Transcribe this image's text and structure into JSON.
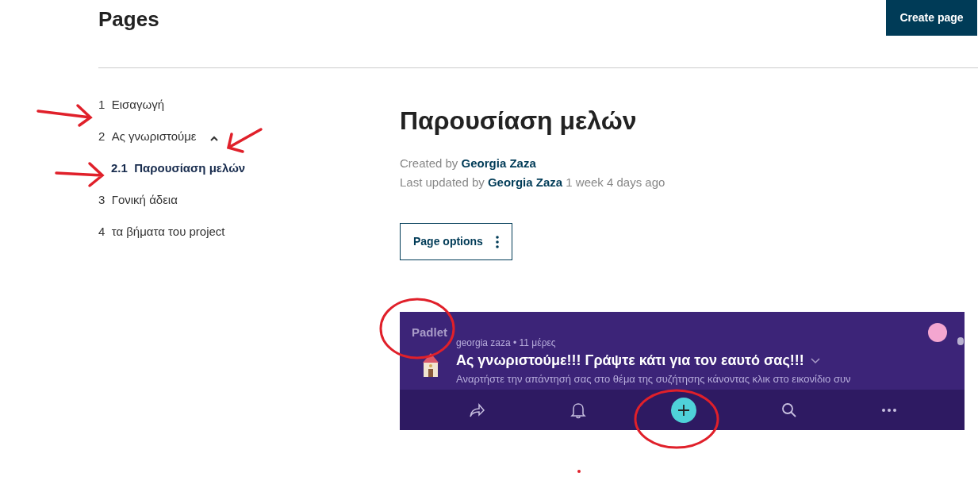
{
  "header": {
    "title": "Pages",
    "create_button": "Create page"
  },
  "nav": [
    {
      "number": "1",
      "label": "Εισαγωγή",
      "selected": false
    },
    {
      "number": "2",
      "label": "Ας γνωριστούμε",
      "selected": false,
      "expanded": true,
      "children": [
        {
          "number": "2.1",
          "label": "Παρουσίαση μελών",
          "selected": true
        }
      ]
    },
    {
      "number": "3",
      "label": "Γονική άδεια",
      "selected": false
    },
    {
      "number": "4",
      "label": "τα βήματα του project",
      "selected": false
    }
  ],
  "page": {
    "title": "Παρουσίαση μελών",
    "created_prefix": "Created by",
    "created_by": "Georgia Zaza",
    "updated_prefix": "Last updated by",
    "updated_by": "Georgia Zaza",
    "updated_when": "1 week 4 days ago",
    "options_button": "Page options"
  },
  "embed": {
    "logo": "Padlet",
    "meta": "georgia zaza • 11 μέρες",
    "title": "Ας γνωριστούμε!!! Γράψτε κάτι για τον εαυτό σας!!!",
    "description": "Αναρτήστε την απάντησή σας στο θέμα της συζήτησης κάνοντας κλικ στο εικονίδιο συν"
  }
}
